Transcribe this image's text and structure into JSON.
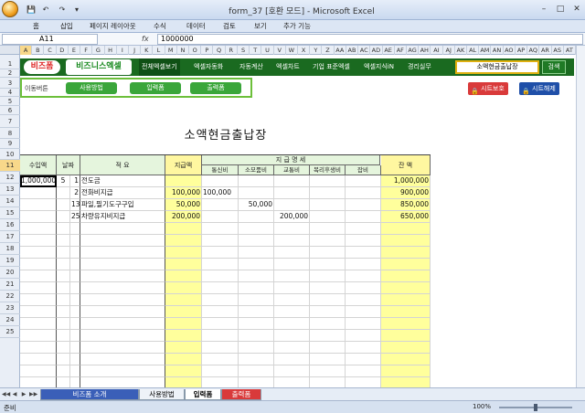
{
  "window": {
    "title": "form_37  [호환 모드]  -  Microsoft Excel",
    "quick_access": [
      "💾",
      "↶",
      "↷",
      "▾"
    ]
  },
  "ribbon": {
    "tabs": [
      "홈",
      "삽입",
      "페이지 레이아웃",
      "수식",
      "데이터",
      "검토",
      "보기",
      "추가 기능"
    ]
  },
  "formula_bar": {
    "cell_ref": "A11",
    "fx": "fx",
    "value": "1000000"
  },
  "columns": [
    "A",
    "B",
    "C",
    "D",
    "E",
    "F",
    "G",
    "H",
    "I",
    "J",
    "K",
    "L",
    "M",
    "N",
    "O",
    "P",
    "Q",
    "R",
    "S",
    "T",
    "U",
    "V",
    "W",
    "X",
    "Y",
    "Z",
    "AA",
    "AB",
    "AC",
    "AD",
    "AE",
    "AF",
    "AG",
    "AH",
    "AI",
    "AJ",
    "AK",
    "AL",
    "AM",
    "AN",
    "AO",
    "AP",
    "AQ",
    "AR",
    "AS",
    "AT"
  ],
  "rows": [
    "1",
    "2",
    "3",
    "4",
    "5",
    "6",
    "7",
    "8",
    "9",
    "10",
    "11",
    "12",
    "13",
    "14",
    "15",
    "16",
    "17",
    "18",
    "19",
    "20",
    "21",
    "22",
    "23",
    "24",
    "25"
  ],
  "brand": {
    "logo1": "비즈폼",
    "logo2": "비즈니스엑셀"
  },
  "menu": [
    "전체엑셀보기",
    "엑셀자동화",
    "자동계산",
    "엑셀차트",
    "기업 표준엑셀",
    "엑셀지식iN",
    "경리실무"
  ],
  "search": {
    "value": "소액현금출납장",
    "button": "검색"
  },
  "nav": {
    "label": "이동버튼",
    "buttons": [
      "사용방법",
      "입력폼",
      "출력폼"
    ]
  },
  "protect": {
    "on": "시트보호",
    "off": "시트해제",
    "on_color": "#d93a3a",
    "off_color": "#1f4fa8"
  },
  "sheet_title": "소액현금출납장",
  "table": {
    "headers": {
      "income": "수입액",
      "date": "날짜",
      "desc": "적   요",
      "paid": "지급액",
      "details": "지   급   명   세",
      "cols": [
        "통신비",
        "소모품비",
        "교통비",
        "복리후생비",
        "잡비"
      ],
      "balance": "잔   액"
    },
    "rows": [
      {
        "income": "1,000,000",
        "m": "5",
        "d": "1",
        "desc": "전도금",
        "paid": "",
        "c1": "",
        "c2": "",
        "c3": "",
        "c4": "",
        "c5": "",
        "balance": "1,000,000"
      },
      {
        "income": "",
        "m": "",
        "d": "2",
        "desc": "전화비지급",
        "paid": "100,000",
        "c1": "100,000",
        "c2": "",
        "c3": "",
        "c4": "",
        "c5": "",
        "balance": "900,000"
      },
      {
        "income": "",
        "m": "",
        "d": "13",
        "desc": "파일,필기도구구입",
        "paid": "50,000",
        "c1": "",
        "c2": "50,000",
        "c3": "",
        "c4": "",
        "c5": "",
        "balance": "850,000"
      },
      {
        "income": "",
        "m": "",
        "d": "25",
        "desc": "차량유지비지급",
        "paid": "200,000",
        "c1": "",
        "c2": "",
        "c3": "200,000",
        "c4": "",
        "c5": "",
        "balance": "650,000"
      }
    ]
  },
  "sheet_tabs": {
    "arrows": [
      "◀◀",
      "◀",
      "▶",
      "▶▶"
    ],
    "tabs": [
      "비즈폼 소개",
      "사용방법",
      "입력폼",
      "출력폼"
    ],
    "active": "입력폼"
  },
  "status": {
    "ready": "준비",
    "zoom": "100%"
  }
}
